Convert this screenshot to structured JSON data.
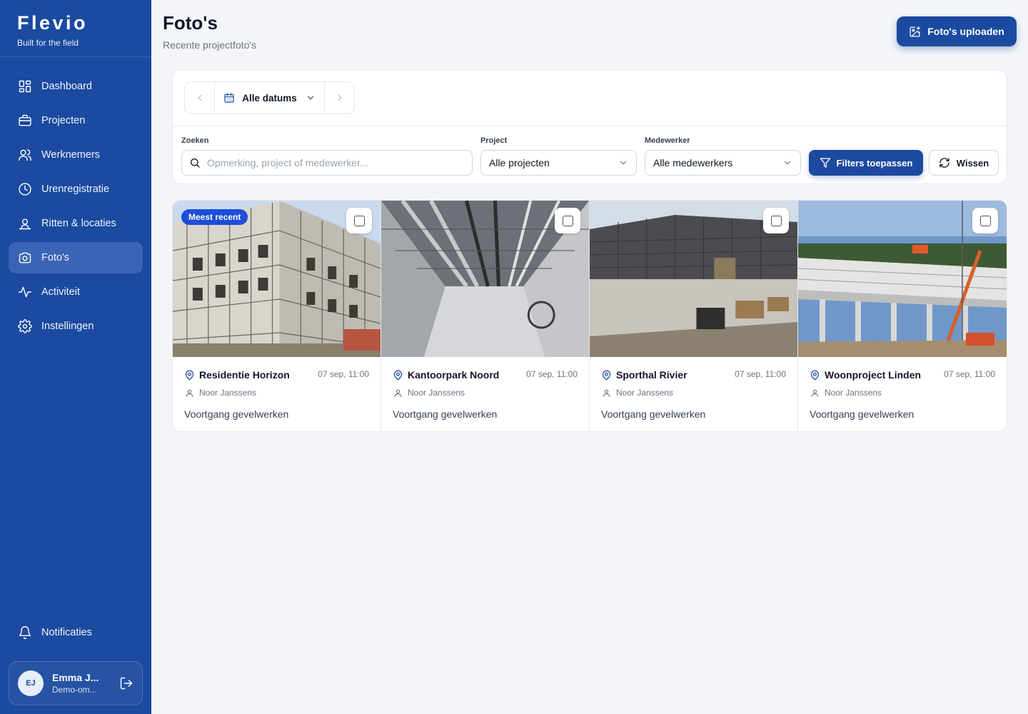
{
  "brand": {
    "name": "Flevio",
    "tagline": "Built for the field"
  },
  "sidebar": {
    "items": [
      {
        "label": "Dashboard",
        "icon": "grid-icon"
      },
      {
        "label": "Projecten",
        "icon": "briefcase-icon"
      },
      {
        "label": "Werknemers",
        "icon": "users-icon"
      },
      {
        "label": "Urenregistratie",
        "icon": "clock-icon"
      },
      {
        "label": "Ritten & locaties",
        "icon": "map-pin-user-icon"
      },
      {
        "label": "Foto's",
        "icon": "camera-icon",
        "active": true
      },
      {
        "label": "Activiteit",
        "icon": "activity-icon"
      },
      {
        "label": "Instellingen",
        "icon": "gear-icon"
      }
    ],
    "notifications_label": "Notificaties"
  },
  "user": {
    "initials": "EJ",
    "name": "Emma J...",
    "role": "Demo-om..."
  },
  "header": {
    "title": "Foto's",
    "subtitle": "Recente projectfoto's",
    "upload_label": "Foto's uploaden"
  },
  "filters": {
    "date_label": "Alle datums",
    "search_label": "Zoeken",
    "search_placeholder": "Opmerking, project of medewerker...",
    "project_label": "Project",
    "project_value": "Alle projecten",
    "employee_label": "Medewerker",
    "employee_value": "Alle medewerkers",
    "apply_label": "Filters toepassen",
    "clear_label": "Wissen"
  },
  "photos": [
    {
      "project": "Residentie Horizon",
      "date": "07 sep, 11:00",
      "user": "Noor Janssens",
      "note": "Voortgang gevelwerken",
      "badge": "Meest recent"
    },
    {
      "project": "Kantoorpark Noord",
      "date": "07 sep, 11:00",
      "user": "Noor Janssens",
      "note": "Voortgang gevelwerken"
    },
    {
      "project": "Sporthal Rivier",
      "date": "07 sep, 11:00",
      "user": "Noor Janssens",
      "note": "Voortgang gevelwerken"
    },
    {
      "project": "Woonproject Linden",
      "date": "07 sep, 11:00",
      "user": "Noor Janssens",
      "note": "Voortgang gevelwerken"
    }
  ],
  "colors": {
    "sidebar": "#1b4aa0",
    "accent": "#1b4aa0",
    "badge": "#1d4ed8"
  }
}
